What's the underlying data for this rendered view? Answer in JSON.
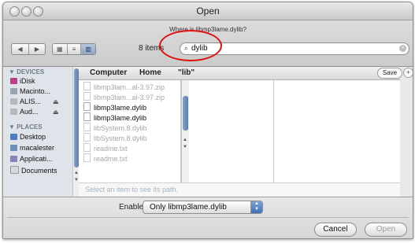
{
  "window": {
    "title": "Open"
  },
  "toolbar": {
    "where_text": "Where is libmp3lame.dylib?",
    "nav": {
      "back_glyph": "◀",
      "forward_glyph": "▶"
    },
    "view": {
      "icon_glyph": "▦",
      "list_glyph": "≡",
      "column_glyph": "▥"
    },
    "item_count": "8 items",
    "search": {
      "icon": "search-icon",
      "glyph": "⌕",
      "value": "dylib",
      "clear_glyph": "×"
    }
  },
  "sidebar": {
    "devices_header": "▼ DEVICES",
    "devices": [
      {
        "label": "iDisk",
        "icon": "idisk-icon",
        "icon_color": "#c43a8a"
      },
      {
        "label": "Macinto...",
        "icon": "hard-drive-icon",
        "icon_color": "#9aa4b0"
      },
      {
        "label": "ALIS...",
        "icon": "external-drive-icon",
        "icon_color": "#b8b8b8",
        "eject": "⏏"
      },
      {
        "label": "Aud...",
        "icon": "external-drive-icon",
        "icon_color": "#b8b8b8",
        "eject": "⏏"
      }
    ],
    "places_header": "▼ PLACES",
    "places": [
      {
        "label": "Desktop",
        "icon": "desktop-icon",
        "icon_color": "#4a7fc1"
      },
      {
        "label": "macalester",
        "icon": "home-icon",
        "icon_color": "#6b8fb8"
      },
      {
        "label": "Applicati...",
        "icon": "applications-icon",
        "icon_color": "#8a7fc0"
      },
      {
        "label": "Documents",
        "icon": "documents-folder-icon",
        "icon_color": "#d8d8d8"
      }
    ]
  },
  "pathbar": {
    "computer": "Computer",
    "home": "Home",
    "lib": "\"lib\"",
    "save": "Save",
    "plus": "+"
  },
  "files": [
    {
      "name": "libmp3lam...al-3.97.zip",
      "enabled": false
    },
    {
      "name": "libmp3lam...al-3.97.zip",
      "enabled": false
    },
    {
      "name": "libmp3lame.dylib",
      "enabled": true
    },
    {
      "name": "libmp3lame.dylib",
      "enabled": true
    },
    {
      "name": "libSystem.8.dylib",
      "enabled": false
    },
    {
      "name": "libSystem.8.dylib",
      "enabled": false
    },
    {
      "name": "readme.txt",
      "enabled": false
    },
    {
      "name": "readme.txt",
      "enabled": false
    }
  ],
  "hint": "Select an item to see its path.",
  "bottom": {
    "enable_label": "Enable:",
    "enable_value": "Only libmp3lame.dylib",
    "cancel": "Cancel",
    "open": "Open"
  },
  "colors": {
    "annotation_circle": "#e01010",
    "selection_blue": "#3f70b8"
  }
}
